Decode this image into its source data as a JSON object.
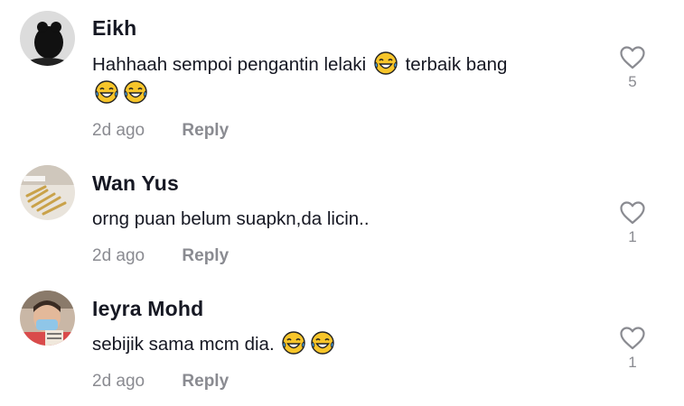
{
  "comments": [
    {
      "username": "Eikh",
      "text_before": "Hahhaah sempoi pengantin lelaki",
      "text_mid": "terbaik bang",
      "time": "2d ago",
      "reply_label": "Reply",
      "likes": "5",
      "emoji": "face-with-tears-of-joy"
    },
    {
      "username": "Wan Yus",
      "text": "orng puan belum suapkn,da licin..",
      "time": "2d ago",
      "reply_label": "Reply",
      "likes": "1"
    },
    {
      "username": "Ieyra Mohd",
      "text": "sebijik sama mcm dia.",
      "time": "2d ago",
      "reply_label": "Reply",
      "likes": "1",
      "emoji": "face-with-tears-of-joy"
    }
  ],
  "colors": {
    "text": "#161823",
    "secondary": "#8a8b91",
    "emoji_face": "#f7c52a",
    "emoji_tear": "#49a6e8"
  }
}
